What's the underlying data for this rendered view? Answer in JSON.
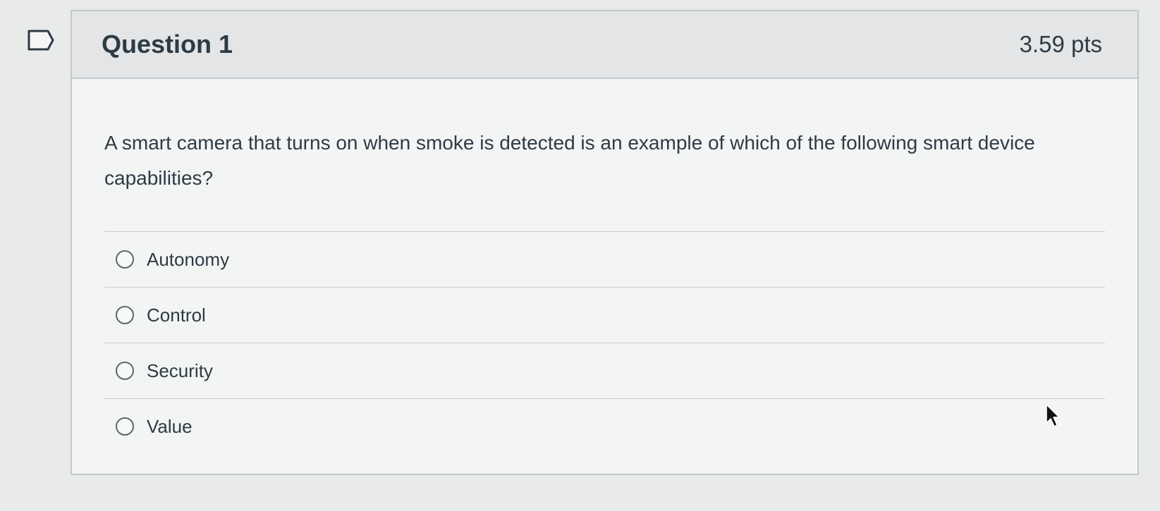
{
  "question": {
    "title": "Question 1",
    "points": "3.59 pts",
    "text": "A smart camera that turns on when smoke is detected is an example of which of the following smart device capabilities?",
    "answers": [
      {
        "label": "Autonomy",
        "selected": false
      },
      {
        "label": "Control",
        "selected": false
      },
      {
        "label": "Security",
        "selected": false
      },
      {
        "label": "Value",
        "selected": false
      }
    ]
  },
  "icons": {
    "flag": "flag-icon",
    "radio": "radio-unchecked-icon",
    "cursor": "mouse-pointer-icon"
  },
  "colors": {
    "page_background": "#e9eaea",
    "card_background": "#f3f4f4",
    "header_background": "#e3e5e6",
    "text": "#2d3b45",
    "border": "#c4c8cb"
  }
}
